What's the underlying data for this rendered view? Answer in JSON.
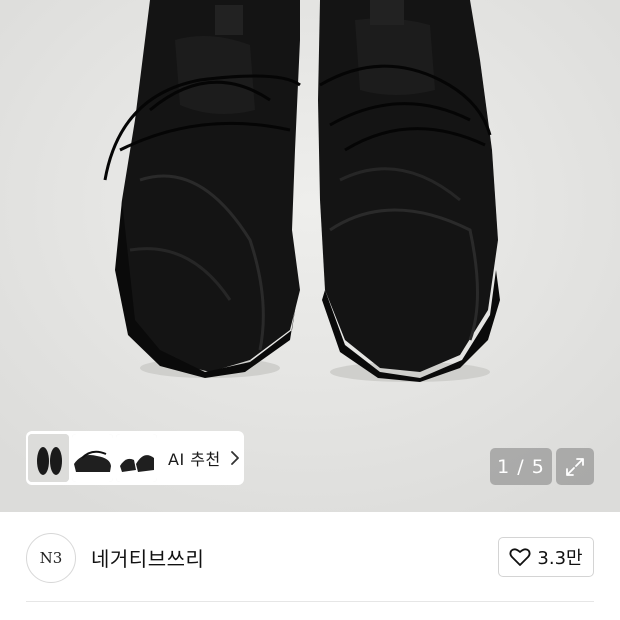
{
  "gallery": {
    "image_alt": "black sneakers",
    "counter": "1 / 5",
    "ai_recommend_label": "AI 추천",
    "thumbnails": [
      "thumb-1",
      "thumb-2",
      "thumb-3"
    ],
    "expand_icon": "expand-icon"
  },
  "shop": {
    "logo_text": "N3",
    "name": "네거티브쓰리",
    "like_count": "3.3만",
    "like_icon": "heart-outline-icon"
  },
  "colors": {
    "overlay": "#808080",
    "text": "#111111"
  }
}
